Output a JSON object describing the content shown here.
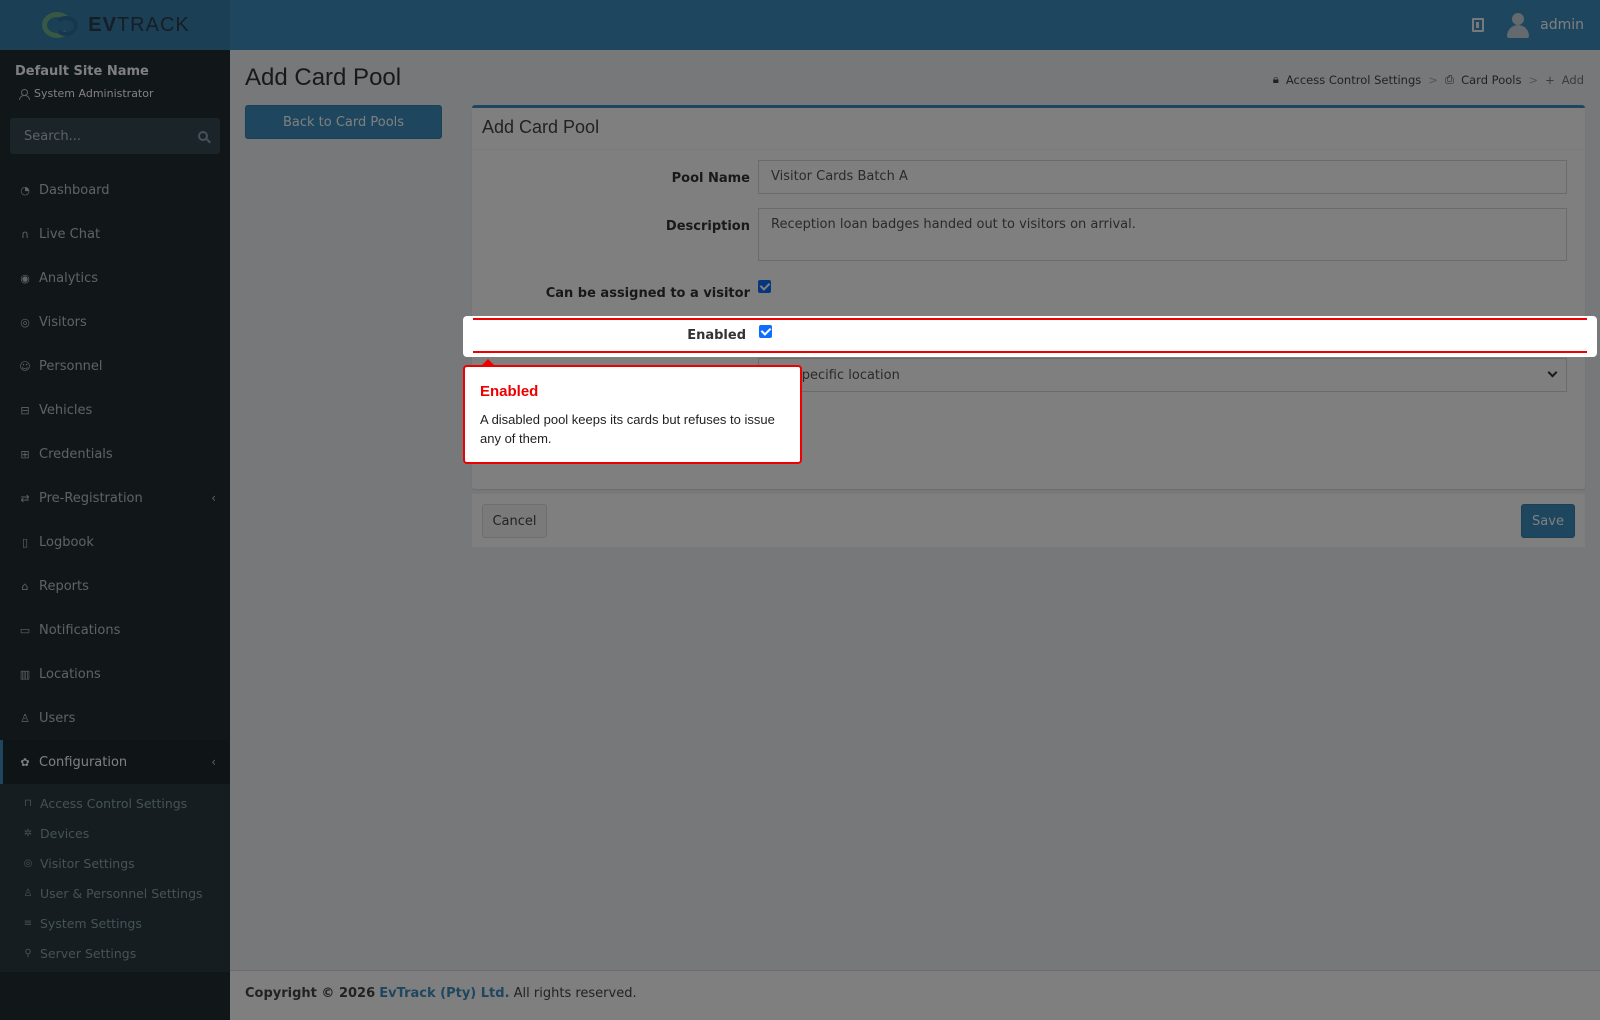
{
  "header": {
    "logo_text_bold": "EV",
    "logo_text_rest": "TRACK",
    "user_name": "admin"
  },
  "sidebar": {
    "site_name": "Default Site Name",
    "role": "System Administrator",
    "search_placeholder": "Search...",
    "items": [
      {
        "label": "Dashboard",
        "icon": "dashboard-icon"
      },
      {
        "label": "Live Chat",
        "icon": "headset-icon"
      },
      {
        "label": "Analytics",
        "icon": "target-icon"
      },
      {
        "label": "Visitors",
        "icon": "eye-icon"
      },
      {
        "label": "Personnel",
        "icon": "user-tie-icon"
      },
      {
        "label": "Vehicles",
        "icon": "car-icon"
      },
      {
        "label": "Credentials",
        "icon": "id-card-icon"
      },
      {
        "label": "Pre-Registration",
        "icon": "swap-icon"
      },
      {
        "label": "Logbook",
        "icon": "book-icon"
      },
      {
        "label": "Reports",
        "icon": "chart-icon"
      },
      {
        "label": "Notifications",
        "icon": "chat-icon"
      },
      {
        "label": "Locations",
        "icon": "map-icon"
      },
      {
        "label": "Users",
        "icon": "users-icon"
      },
      {
        "label": "Configuration",
        "icon": "gear-icon"
      }
    ],
    "submenu": [
      {
        "label": "Access Control Settings",
        "icon": "lock-icon"
      },
      {
        "label": "Devices",
        "icon": "cog-icon"
      },
      {
        "label": "Visitor Settings",
        "icon": "eye-icon"
      },
      {
        "label": "User & Personnel Settings",
        "icon": "users-cog-icon"
      },
      {
        "label": "System Settings",
        "icon": "sliders-icon"
      },
      {
        "label": "Server Settings",
        "icon": "wrench-icon"
      }
    ]
  },
  "page": {
    "title": "Add Card Pool",
    "breadcrumb": [
      "Access Control Settings",
      "Card Pools",
      "Add"
    ],
    "back_button": "Back to Card Pools"
  },
  "form": {
    "title": "Add Card Pool",
    "pool_name_label": "Pool Name",
    "pool_name_value": "Visitor Cards Batch A",
    "description_label": "Description",
    "description_value": "Reception loan badges handed out to visitors on arrival.",
    "visitor_label": "Can be assigned to a visitor",
    "visitor_checked": true,
    "enabled_label": "Enabled",
    "enabled_checked": true,
    "location_value": "specific location",
    "cancel_label": "Cancel",
    "save_label": "Save"
  },
  "tooltip": {
    "title": "Enabled",
    "body": "A disabled pool keeps its cards but refuses to issue any of them."
  },
  "footer": {
    "copyright": "Copyright © 2026",
    "company": "EvTrack (Pty) Ltd.",
    "rights": "All rights reserved."
  },
  "colors": {
    "header": "#3c8dbc",
    "sidebar": "#222d32",
    "highlight": "#e00000"
  }
}
